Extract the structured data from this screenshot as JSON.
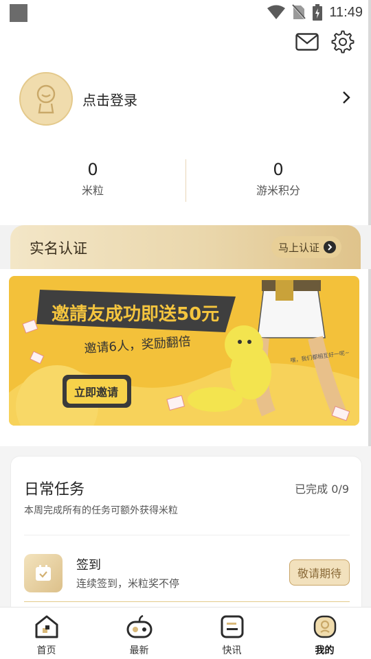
{
  "status_bar": {
    "time": "11:49"
  },
  "header": {
    "icons": [
      "mail-icon",
      "gear-icon"
    ]
  },
  "profile": {
    "login_text": "点击登录"
  },
  "stats": [
    {
      "value": "0",
      "label": "米粒"
    },
    {
      "value": "0",
      "label": "游米积分"
    }
  ],
  "realname": {
    "title": "实名认证",
    "button_label": "马上认证"
  },
  "banner": {
    "headline": "邀請友成功即送50元",
    "subline": "邀请6人，奖励翻倍",
    "button_label": "立即邀请",
    "bubble": "嘿，我们都相互好一呢~"
  },
  "daily_tasks": {
    "title": "日常任务",
    "progress": "已完成 0/9",
    "subtitle": "本周完成所有的任务可额外获得米粒",
    "items": [
      {
        "name": "签到",
        "desc": "连续签到，米粒奖不停",
        "button_label": "敬请期待"
      }
    ]
  },
  "bottom_nav": [
    {
      "label": "首页",
      "icon": "home-icon",
      "active": false
    },
    {
      "label": "最新",
      "icon": "gamepad-icon",
      "active": false
    },
    {
      "label": "快讯",
      "icon": "news-icon",
      "active": false
    },
    {
      "label": "我的",
      "icon": "profile-icon",
      "active": true
    }
  ],
  "colors": {
    "gold": "#dfc38b",
    "banner_yellow": "#f3c13a",
    "accent_text": "#8a6a38"
  }
}
